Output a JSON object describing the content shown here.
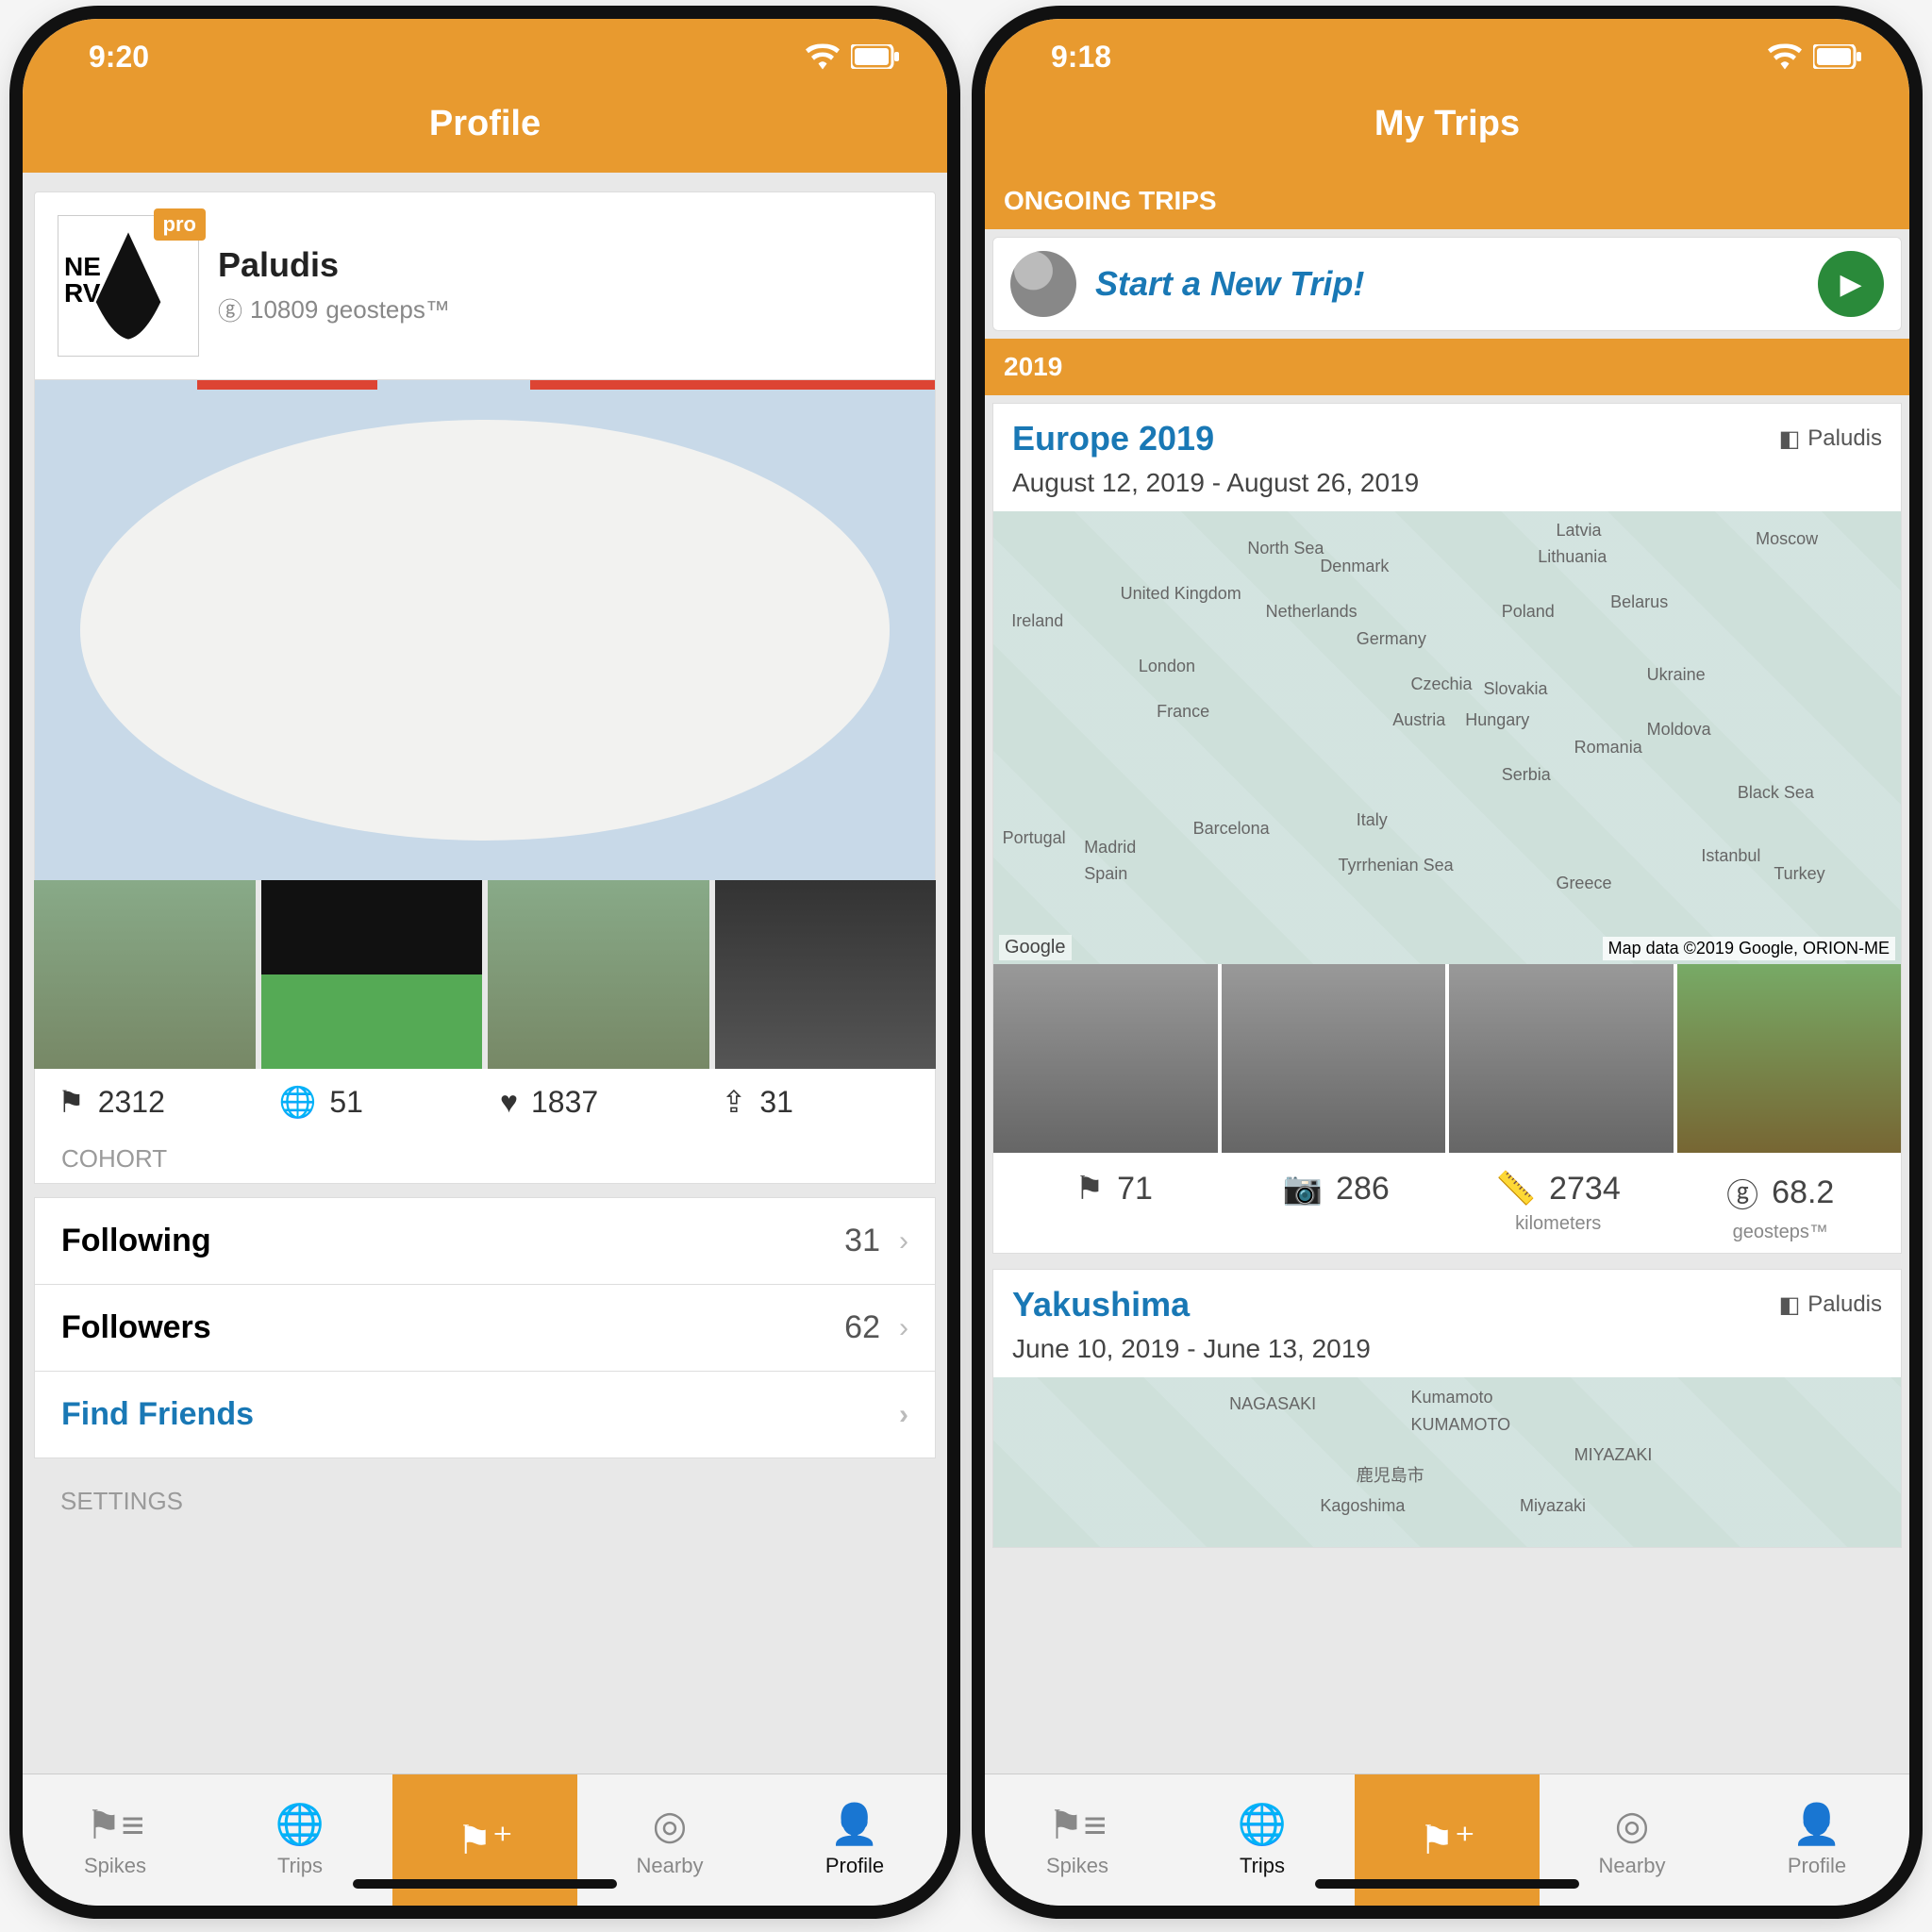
{
  "left": {
    "statusTime": "9:20",
    "headerTitle": "Profile",
    "profile": {
      "proBadge": "pro",
      "avatarText": "NE\nRV",
      "username": "Paludis",
      "geostepsCount": "10809",
      "geostepsLabel": "geosteps™"
    },
    "stats": {
      "flags": "2312",
      "globes": "51",
      "hearts": "1837",
      "shares": "31"
    },
    "cohortLabel": "COHORT",
    "rows": {
      "followingLabel": "Following",
      "followingCount": "31",
      "followersLabel": "Followers",
      "followersCount": "62",
      "findFriends": "Find Friends"
    },
    "settingsLabel": "SETTINGS",
    "tabs": [
      "Spikes",
      "Trips",
      "",
      "Nearby",
      "Profile"
    ]
  },
  "right": {
    "statusTime": "9:18",
    "headerTitle": "My Trips",
    "ongoingLabel": "ONGOING TRIPS",
    "newTrip": "Start a New Trip!",
    "yearLabel": "2019",
    "trip1": {
      "title": "Europe 2019",
      "owner": "Paludis",
      "dates": "August 12, 2019 - August 26, 2019",
      "mapLabels": [
        "United Kingdom",
        "Germany",
        "Poland",
        "France",
        "Italy",
        "Spain",
        "Ukraine",
        "Romania",
        "Turkey",
        "Belarus",
        "Lithuania",
        "Latvia",
        "Moscow",
        "North Sea",
        "Black Sea",
        "Ireland",
        "Denmark",
        "Netherlands",
        "Czechia",
        "Austria",
        "Hungary",
        "Slovakia",
        "Moldova",
        "Serbia",
        "Greece",
        "Portugal",
        "Madrid",
        "Barcelona",
        "London",
        "Istanbul",
        "Tyrrhenian Sea"
      ],
      "googleBadge": "Google",
      "attribution": "Map data ©2019 Google, ORION-ME",
      "stats": {
        "flags": "71",
        "photos": "286",
        "distance": "2734",
        "distanceUnit": "kilometers",
        "geosteps": "68.2",
        "geostepsUnit": "geosteps™"
      }
    },
    "trip2": {
      "title": "Yakushima",
      "owner": "Paludis",
      "dates": "June 10, 2019 - June 13, 2019",
      "mapLabels": [
        "NAGASAKI",
        "Kumamoto",
        "KUMAMOTO",
        "MIYAZAKI",
        "Kagoshima",
        "Miyazaki",
        "鹿児島市"
      ]
    },
    "tabs": [
      "Spikes",
      "Trips",
      "",
      "Nearby",
      "Profile"
    ]
  }
}
